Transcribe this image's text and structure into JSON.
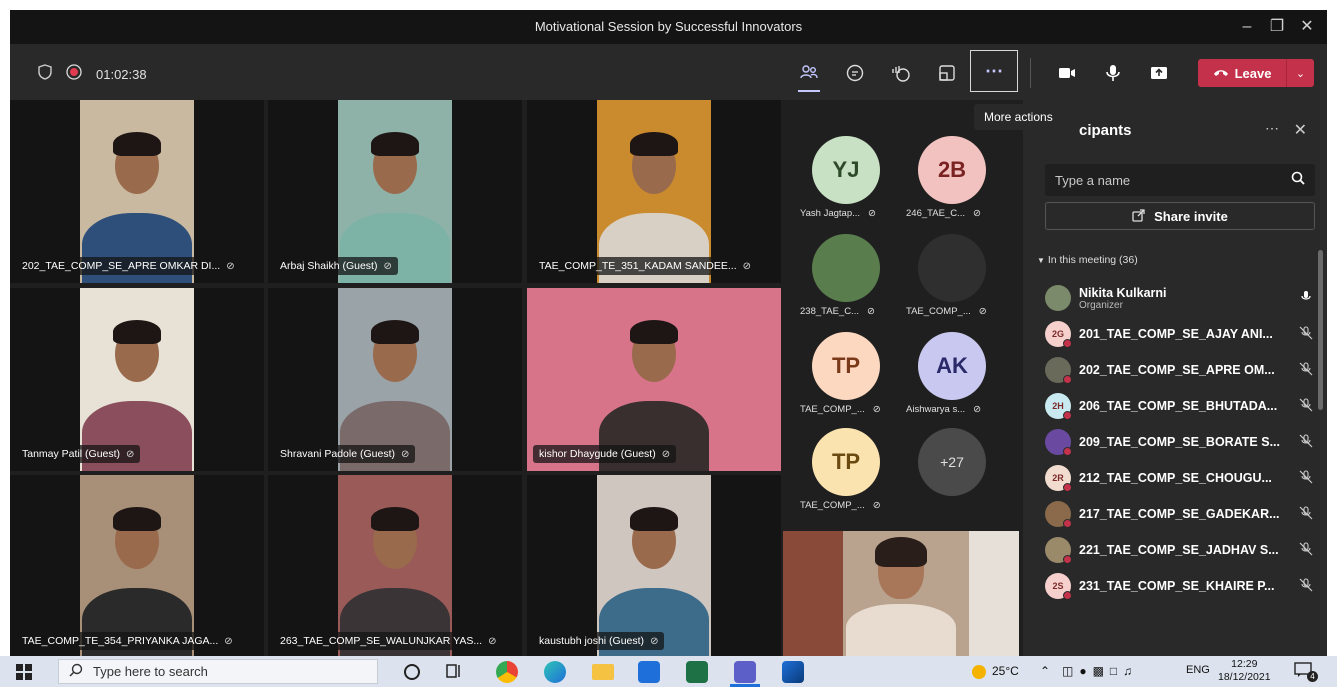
{
  "window": {
    "title": "Motivational Session by Successful Innovators"
  },
  "toolbar": {
    "timer": "01:02:38",
    "leave_label": "Leave",
    "more_tooltip": "More actions",
    "accent": "#c4314b"
  },
  "video_tiles": [
    {
      "name": "202_TAE_COMP_SE_APRE OMKAR DI...",
      "bg": "#c9b9a0",
      "shirt": "#2d4f7a"
    },
    {
      "name": "Arbaj Shaikh (Guest)",
      "bg": "#8fb2a8",
      "shirt": "#7db3a6"
    },
    {
      "name": "TAE_COMP_TE_351_KADAM SANDEE...",
      "bg": "#c98b2e",
      "shirt": "#d8d0c4"
    },
    {
      "name": "Tanmay Patil (Guest)",
      "bg": "#e8e2d6",
      "shirt": "#8a4e5c"
    },
    {
      "name": "Shravani Padole (Guest)",
      "bg": "#9aa3a8",
      "shirt": "#7a6a6a"
    },
    {
      "name": "kishor Dhaygude (Guest)",
      "bg": "#d7748a",
      "shirt": "#3a2f2f"
    },
    {
      "name": "TAE_COMP_TE_354_PRIYANKA JAGA...",
      "bg": "#a88f78",
      "shirt": "#2a2a2a"
    },
    {
      "name": "263_TAE_COMP_SE_WALUNJKAR YAS...",
      "bg": "#9a5a58",
      "shirt": "#3a3436"
    },
    {
      "name": "kaustubh joshi (Guest)",
      "bg": "#cfc6bf",
      "shirt": "#3d6b8a"
    }
  ],
  "gallery": [
    {
      "initials": "YJ",
      "label": "Yash Jagtap...",
      "bg": "#c8e0c4",
      "fg": "#2c4a28"
    },
    {
      "initials": "2B",
      "label": "246_TAE_C...",
      "bg": "#f2c2c0",
      "fg": "#7a2222"
    },
    {
      "initials": "",
      "label": "238_TAE_C...",
      "bg": "#5a7d4e",
      "fg": "#fff"
    },
    {
      "initials": "",
      "label": "TAE_COMP_...",
      "bg": "#2f2f2f",
      "fg": "#fff"
    },
    {
      "initials": "TP",
      "label": "TAE_COMP_...",
      "bg": "#fcd8c0",
      "fg": "#7a3a1a"
    },
    {
      "initials": "AK",
      "label": "Aishwarya s...",
      "bg": "#c9c8f0",
      "fg": "#2a2a6a"
    },
    {
      "initials": "TP",
      "label": "TAE_COMP_...",
      "bg": "#fbe3b0",
      "fg": "#6a4a10"
    },
    {
      "initials": "+27",
      "label": "",
      "bg": "#4a4a4a",
      "fg": "#e0e0e0"
    }
  ],
  "panel": {
    "title": "cipants",
    "search_placeholder": "Type a name",
    "share_label": "Share invite",
    "section_label": "In this meeting (36)",
    "participants": [
      {
        "name": "Nikita Kulkarni",
        "role": "Organizer",
        "initials": "",
        "bg": "#7a8a6a",
        "muted": false
      },
      {
        "name": "201_TAE_COMP_SE_AJAY ANI...",
        "initials": "2G",
        "bg": "#f6d0cc",
        "muted": true
      },
      {
        "name": "202_TAE_COMP_SE_APRE OM...",
        "initials": "",
        "bg": "#6a6a5a",
        "muted": true
      },
      {
        "name": "206_TAE_COMP_SE_BHUTADA...",
        "initials": "2H",
        "bg": "#c8eaf0",
        "muted": true
      },
      {
        "name": "209_TAE_COMP_SE_BORATE S...",
        "initials": "",
        "bg": "#6a4aa0",
        "muted": true
      },
      {
        "name": "212_TAE_COMP_SE_CHOUGU...",
        "initials": "2R",
        "bg": "#f2dcd0",
        "muted": true
      },
      {
        "name": "217_TAE_COMP_SE_GADEKAR...",
        "initials": "",
        "bg": "#8a6a4a",
        "muted": true
      },
      {
        "name": "221_TAE_COMP_SE_JADHAV S...",
        "initials": "",
        "bg": "#9a8a6a",
        "muted": true
      },
      {
        "name": "231_TAE_COMP_SE_KHAIRE P...",
        "initials": "2S",
        "bg": "#f6d0cc",
        "muted": true
      }
    ]
  },
  "taskbar": {
    "search_placeholder": "Type here to search",
    "weather": "25°C",
    "lang": "ENG",
    "time": "12:29",
    "date": "18/12/2021",
    "notifications": "4"
  }
}
